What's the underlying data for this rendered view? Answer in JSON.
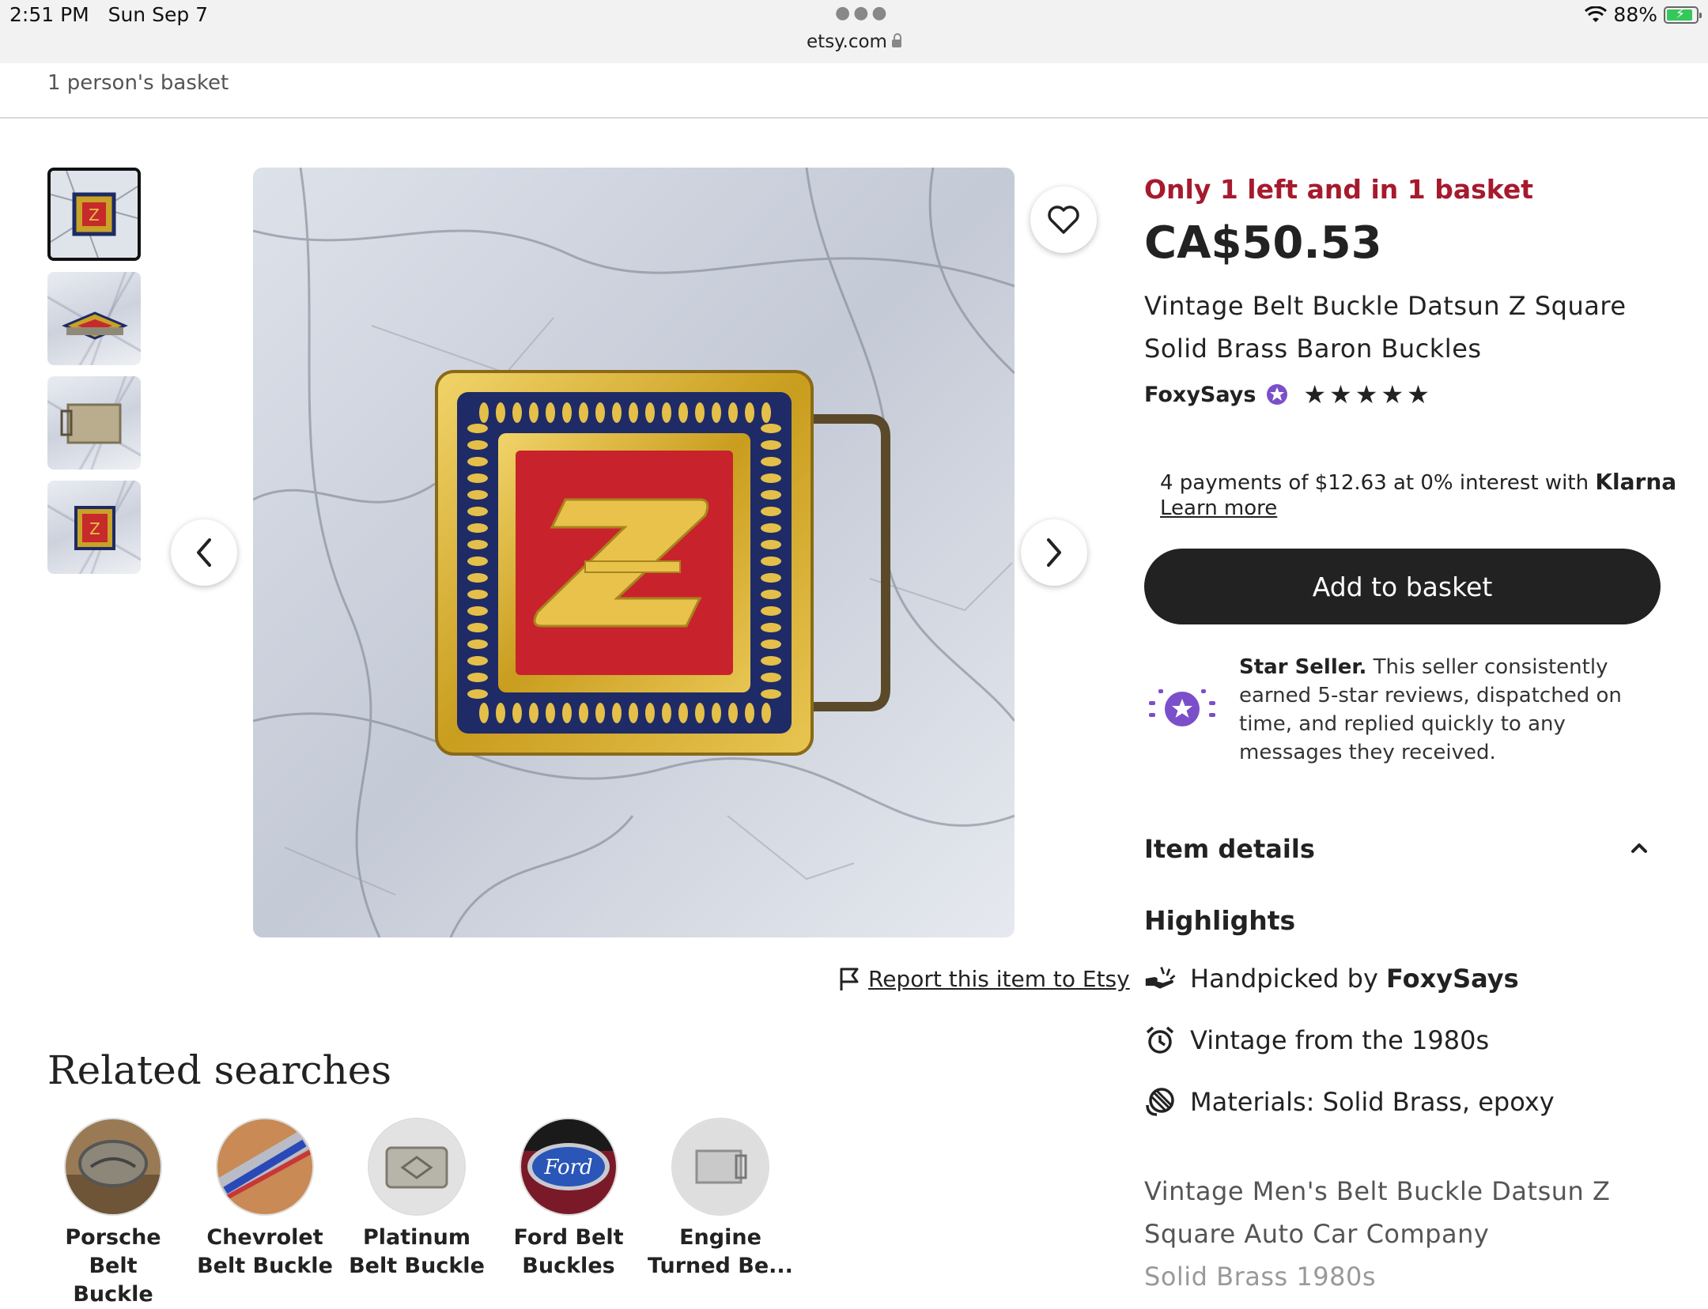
{
  "status_bar": {
    "time": "2:51 PM",
    "date": "Sun Sep 7",
    "url": "etsy.com",
    "battery": "88%",
    "battery_level": 0.88
  },
  "basket_notice": "1 person's basket",
  "gallery": {
    "thumbnails": [
      "thumbnail-1",
      "thumbnail-2",
      "thumbnail-3",
      "thumbnail-4"
    ],
    "active_index": 0,
    "report_label": "Report this item to Etsy"
  },
  "product": {
    "stock_text": "Only 1 left and in 1 basket",
    "price": "CA$50.53",
    "title_line1": "Vintage Belt Buckle Datsun Z Square",
    "title_line2": "Solid Brass Baron Buckles",
    "seller_name": "FoxySays",
    "rating": 5,
    "klarna_text": "4 payments of $12.63 at 0% interest with",
    "klarna_brand": "Klarna",
    "klarna_learn": "Learn more",
    "add_to_basket": "Add to basket",
    "star_seller_title": "Star Seller.",
    "star_seller_text": "This seller consistently earned 5-star reviews, dispatched on time, and replied quickly to any messages they received.",
    "item_details_label": "Item details",
    "highlights_label": "Highlights",
    "highlight_handpicked_prefix": "Handpicked by",
    "highlight_handpicked_seller": "FoxySays",
    "highlight_vintage": "Vintage from the 1980s",
    "highlight_materials": "Materials: Solid Brass, epoxy",
    "description_line1": "Vintage Men's Belt Buckle Datsun Z",
    "description_line2": "Square Auto Car Company",
    "description_line3": "Solid Brass 1980s"
  },
  "related": {
    "title": "Related searches",
    "items": [
      {
        "line1": "Porsche Belt",
        "line2": "Buckle"
      },
      {
        "line1": "Chevrolet",
        "line2": "Belt Buckle"
      },
      {
        "line1": "Platinum",
        "line2": "Belt Buckle"
      },
      {
        "line1": "Ford Belt",
        "line2": "Buckles"
      },
      {
        "line1": "Engine",
        "line2": "Turned Be..."
      }
    ]
  },
  "colors": {
    "accent_red": "#a61a2e",
    "button_dark": "#222222",
    "star_seller_purple": "#7b4fc9"
  }
}
